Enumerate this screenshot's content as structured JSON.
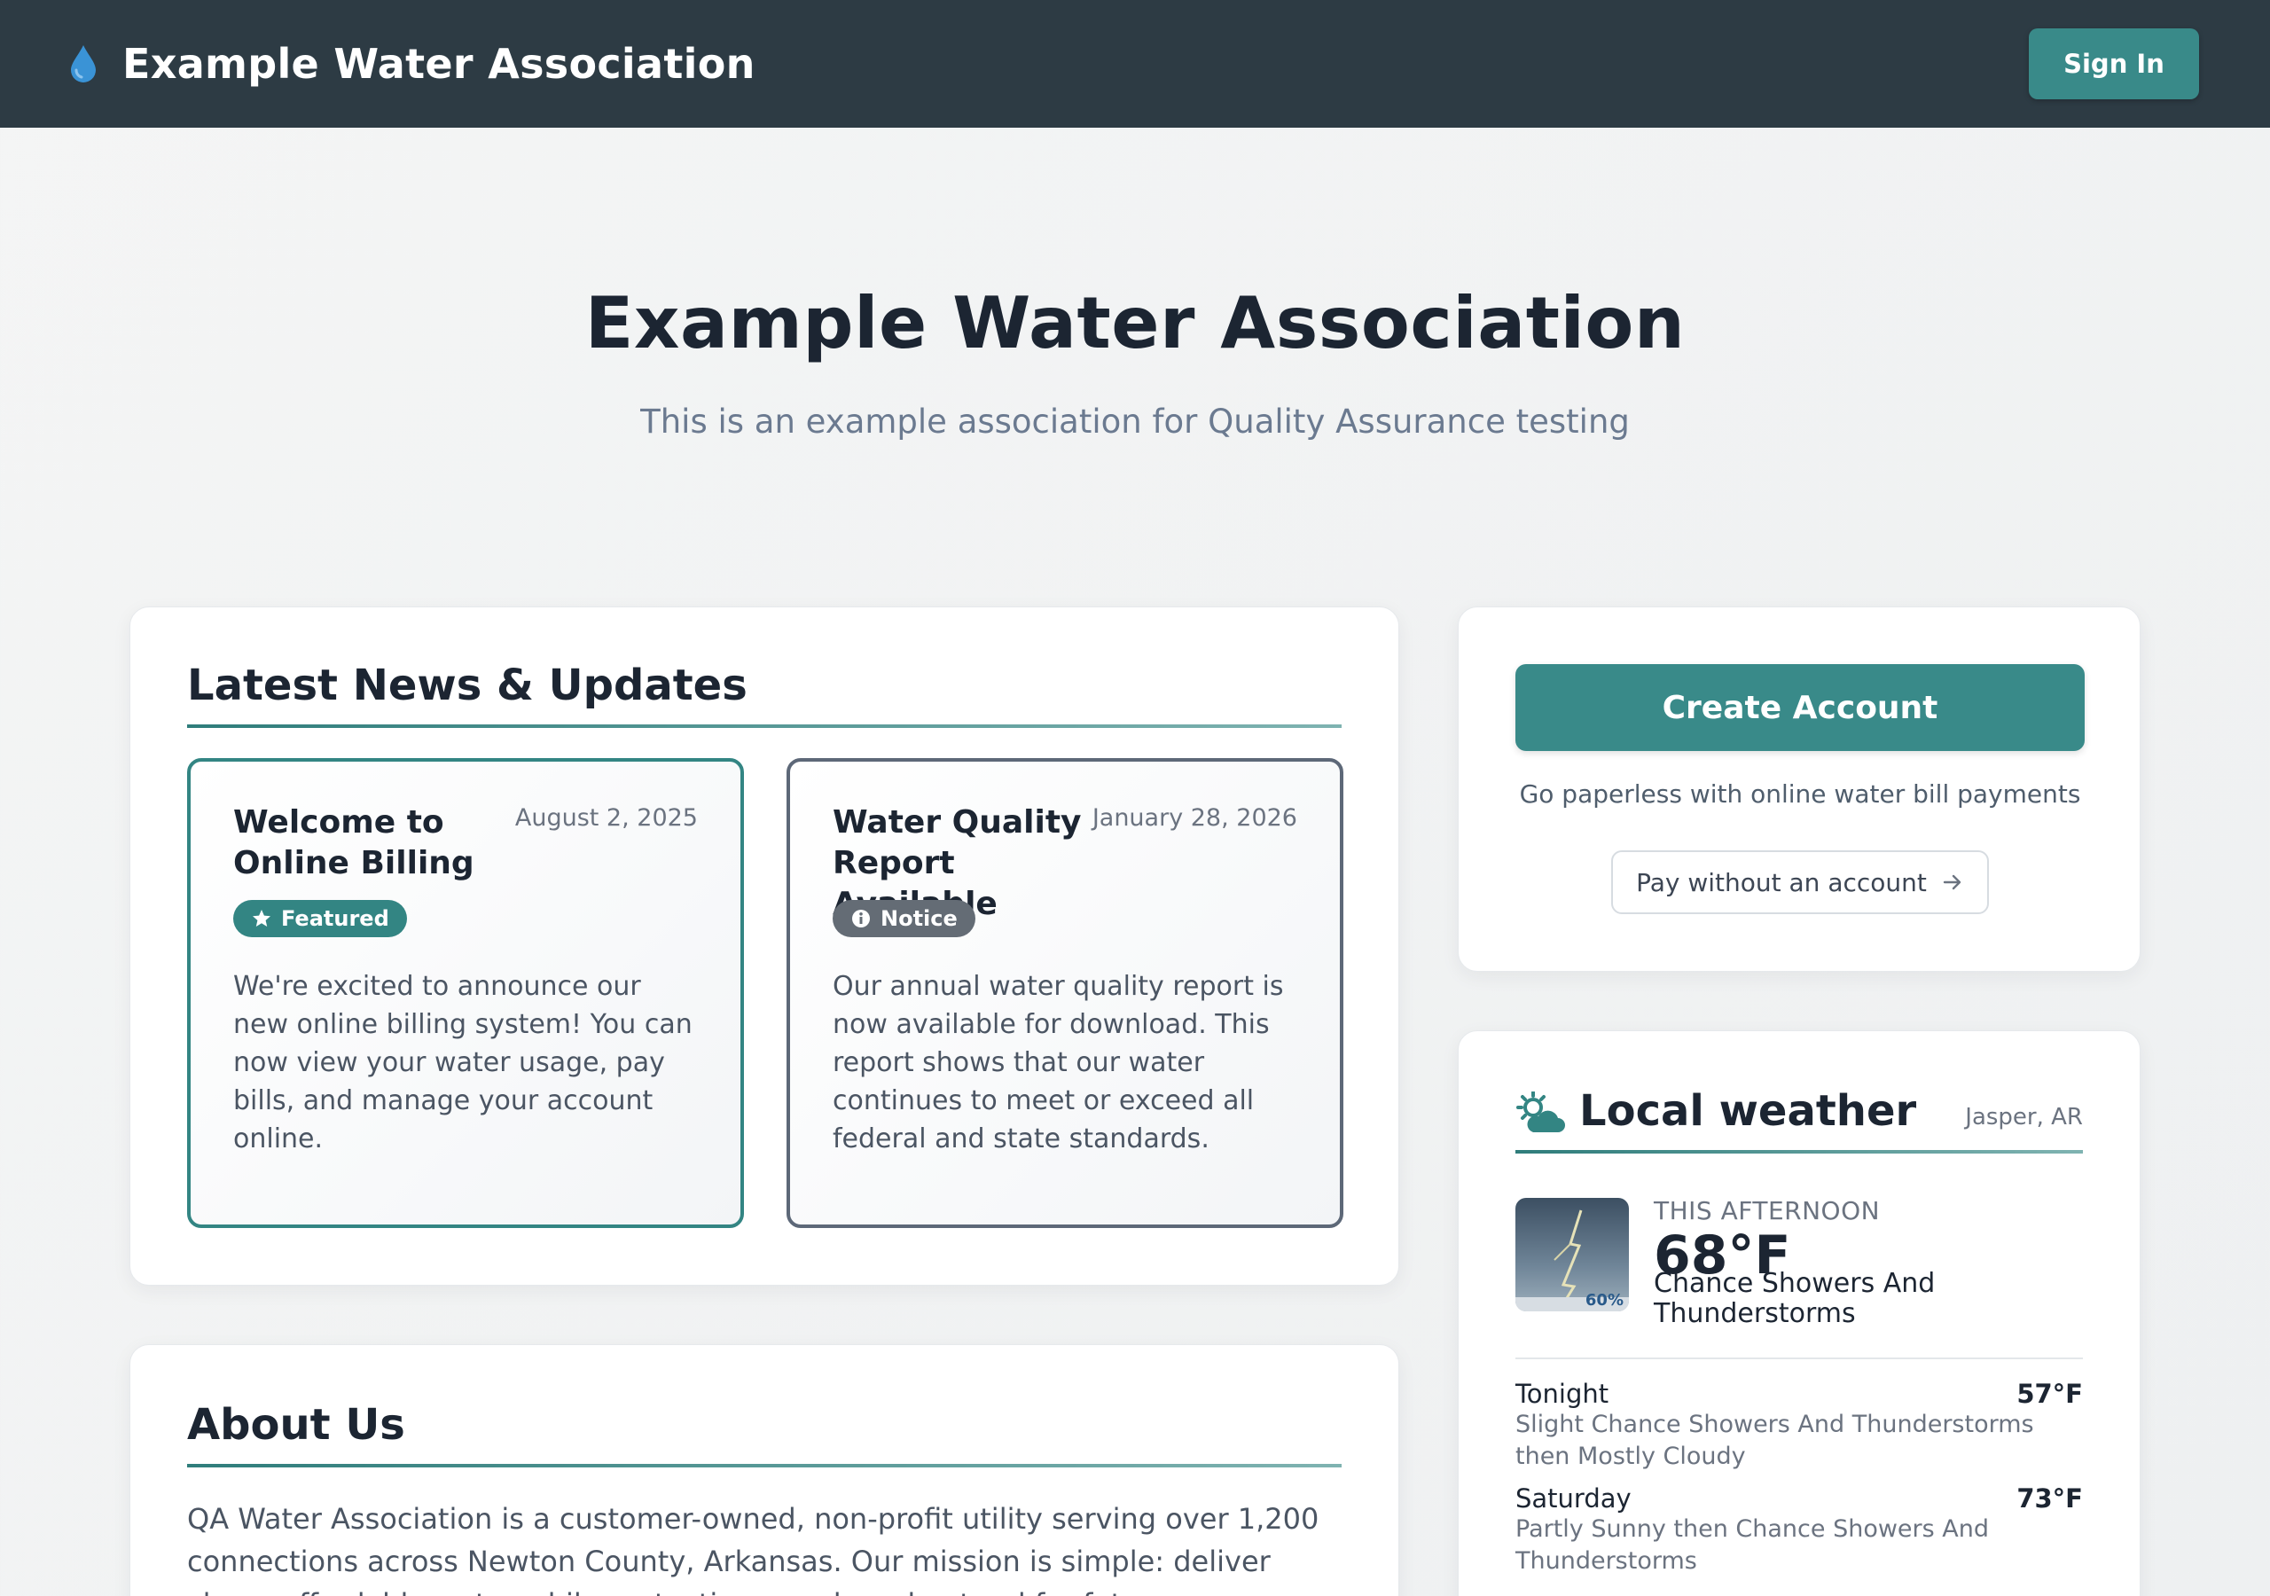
{
  "header": {
    "brand_name": "Example Water Association",
    "brand_icon": "water-drop-icon",
    "signin_label": "Sign In"
  },
  "hero": {
    "title": "Example Water Association",
    "subtitle": "This is an example association for Quality Assurance testing"
  },
  "news": {
    "title": "Latest News & Updates",
    "items": [
      {
        "title": "Welcome to Online Billing",
        "date": "August 2, 2025",
        "badge": "Featured",
        "badge_icon": "star-icon",
        "body": "We're excited to announce our new online billing system! You can now view your water usage, pay bills, and manage your account online."
      },
      {
        "title": "Water Quality Report Available",
        "date": "January 28, 2026",
        "badge": "Notice",
        "badge_icon": "info-icon",
        "body": "Our annual water quality report is now available for download. This report shows that our water continues to meet or exceed all federal and state standards."
      }
    ]
  },
  "about": {
    "title": "About Us",
    "text": "QA Water Association is a customer-owned, non-profit utility serving over 1,200 connections across Newton County, Arkansas. Our mission is simple: deliver clean, affordable water while protecting our shared natural for future generations."
  },
  "account": {
    "create_label": "Create Account",
    "note": "Go paperless with online water bill payments",
    "pay_label": "Pay without an account"
  },
  "weather": {
    "title": "Local weather",
    "location": "Jasper, AR",
    "current": {
      "period": "THIS AFTERNOON",
      "temp": "68°F",
      "description": "Chance Showers And Thunderstorms",
      "precip": "60%"
    },
    "forecast": [
      {
        "name": "Tonight",
        "temp": "57°F",
        "desc": "Slight Chance Showers And Thunderstorms then Mostly Cloudy"
      },
      {
        "name": "Saturday",
        "temp": "73°F",
        "desc": "Partly Sunny then Chance Showers And Thunderstorms"
      }
    ]
  },
  "colors": {
    "header_bg": "#2d3b44",
    "accent": "#398a89",
    "notice": "#646c75"
  }
}
